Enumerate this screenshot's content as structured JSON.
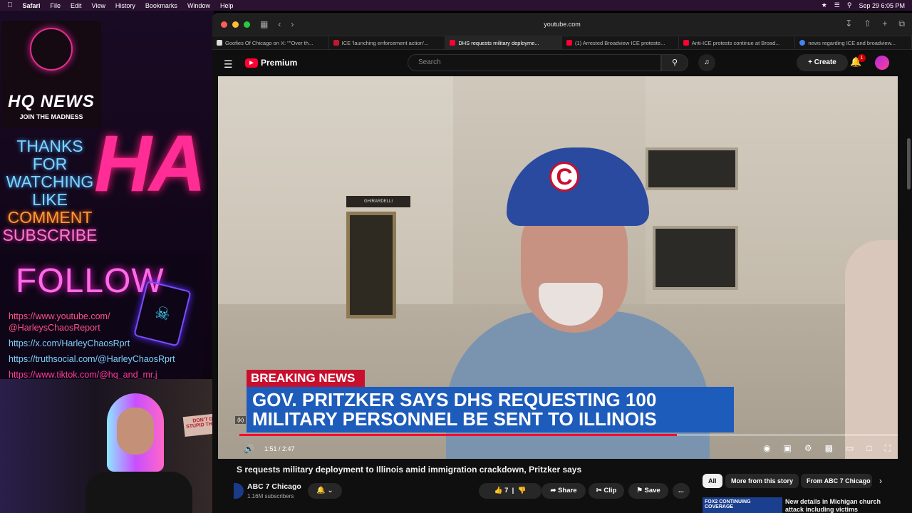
{
  "menubar": {
    "apple": "",
    "app": "Safari",
    "items": [
      "File",
      "Edit",
      "View",
      "History",
      "Bookmarks",
      "Window",
      "Help"
    ],
    "datetime": "Sep 29  6:05 PM"
  },
  "overlay": {
    "logo_title": "HQ NEWS",
    "logo_sub": "JOIN THE MADNESS",
    "big_text": "HA",
    "lines": [
      "THANKS",
      "FOR",
      "WATCHING",
      "LIKE",
      "COMMENT",
      "SUBSCRIBE"
    ],
    "follow": "FOLLOW",
    "links": [
      "https://www.youtube.com/",
      "@HarleysChaosReport",
      "https://x.com/HarleyChaosRprt",
      "https://truthsocial.com/@HarleyChaosRprt",
      "https://www.tiktok.com/@hq_and_mr.j"
    ]
  },
  "webcam": {
    "sign_text": "DON'T DO STUPID THINGS"
  },
  "browser": {
    "url": "youtube.com",
    "tabs": [
      {
        "label": "Goofies Of Chicago on X: \"\"Over th...",
        "icon": "x"
      },
      {
        "label": "ICE 'launching enforcement action'...",
        "icon": "n"
      },
      {
        "label": "DHS requests military deployme...",
        "icon": "yt",
        "active": true
      },
      {
        "label": "(1) Arrested Broadview ICE proteste...",
        "icon": "yt"
      },
      {
        "label": "Anti-ICE protests continue at Broad...",
        "icon": "yt"
      },
      {
        "label": "news regarding ICE and broadview...",
        "icon": "g"
      }
    ]
  },
  "youtube": {
    "logo": "Premium",
    "search_placeholder": "Search",
    "create": "Create",
    "notif_count": "1",
    "video": {
      "breaking": "BREAKING NEWS",
      "headline": "GOV. PRITZKER SAYS DHS REQUESTING 100 MILITARY PERSONNEL BE SENT TO ILLINOIS",
      "store_sign": "GHIRARDELLI",
      "k_hint": "(k)",
      "time": "1:51 / 2:47",
      "progress": 0.665
    },
    "title": "S requests military deployment to Illinois amid immigration crackdown, Pritzker says",
    "channel": "ABC 7 Chicago",
    "subscribers": "1.16M subscribers",
    "likes": "7",
    "share": "Share",
    "clip": "Clip",
    "save": "Save",
    "more": "...",
    "chips": [
      "All",
      "More from this story",
      "From ABC 7 Chicago"
    ],
    "rec_badge": "FOX2 CONTINUING COVERAGE",
    "rec_title": "New details in Michigan church attack including victims"
  },
  "colors": {
    "yt_red": "#ff0033",
    "cubs_blue": "#2a4aa0",
    "abc_blue": "#1e5cbb",
    "breaking_red": "#c8102e"
  }
}
